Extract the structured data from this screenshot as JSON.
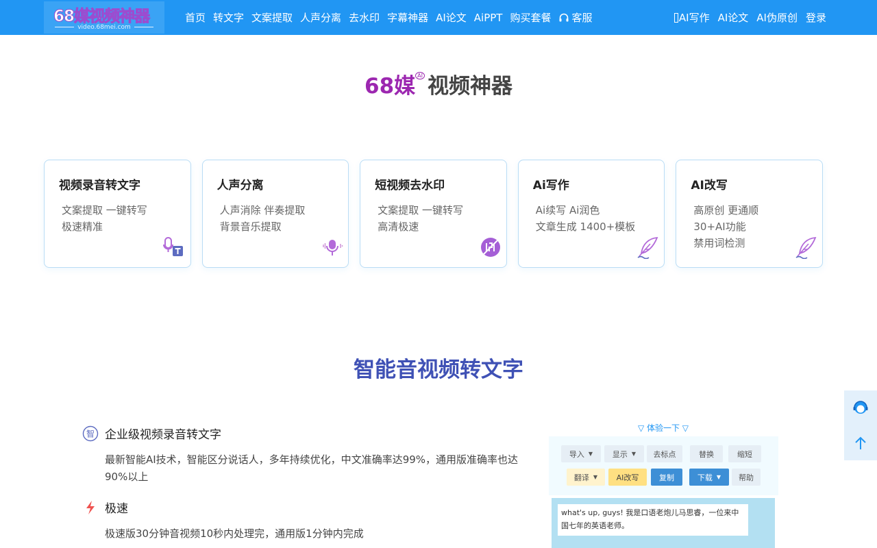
{
  "logo": {
    "text": "68媒视频神器",
    "subtext": "video.68mei.com"
  },
  "nav": {
    "items": [
      "首页",
      "转文字",
      "文案提取",
      "人声分离",
      "去水印",
      "字幕神器",
      "AI论文",
      "AiPPT",
      "购买套餐"
    ],
    "service": "客服",
    "right": [
      "AI写作",
      "AI论文",
      "AI伪原创",
      "登录"
    ]
  },
  "hero": {
    "brand": "68媒",
    "badge": "AI",
    "rest": "视频神器"
  },
  "cards": [
    {
      "title": "视频录音转文字",
      "lines": [
        "文案提取  一键转写",
        "极速精准"
      ],
      "icon": "mic-text-icon"
    },
    {
      "title": "人声分离",
      "lines": [
        "人声消除  伴奏提取",
        "背景音乐提取"
      ],
      "icon": "microphone-icon"
    },
    {
      "title": "短视频去水印",
      "lines": [
        "文案提取  一键转写",
        "高清极速"
      ],
      "icon": "watermark-stamp-icon"
    },
    {
      "title": "Ai写作",
      "lines": [
        "Ai续写  Ai润色",
        "文章生成  1400+模板"
      ],
      "icon": "feather-pen-icon"
    },
    {
      "title": "AI改写",
      "lines": [
        "高原创  更通顺",
        "30+AI功能",
        "禁用词检测"
      ],
      "icon": "feather-pen-icon"
    }
  ],
  "section": {
    "title": "智能音视频转文字"
  },
  "features": [
    {
      "title": "企业级视频录音转文字",
      "text": "最新智能AI技术，智能区分说话人，多年持续优化，中文准确率达99%，通用版准确率也达90%以上",
      "icon": "zhi-badge-icon"
    },
    {
      "title": "极速",
      "text": "极速版30分钟音视频10秒内处理完，通用版1分钟内完成",
      "icon": "lightning-icon"
    }
  ],
  "demo": {
    "hint": "▽ 体验一下 ▽",
    "toolbar_row1": [
      "导入",
      "显示",
      "去标点",
      "替换",
      "缩短"
    ],
    "toolbar_row2": [
      "翻译",
      "AI改写",
      "复制",
      "下载",
      "帮助"
    ],
    "text": "what's up, guys! 我是口语老炮儿马思睿，一位来中国七年的英语老师。"
  },
  "colors": {
    "topbar": "#2196f3",
    "brand_purple": "#9c27b0",
    "section_title": "#3f51b5",
    "accent_blue": "#3d8fd6"
  }
}
